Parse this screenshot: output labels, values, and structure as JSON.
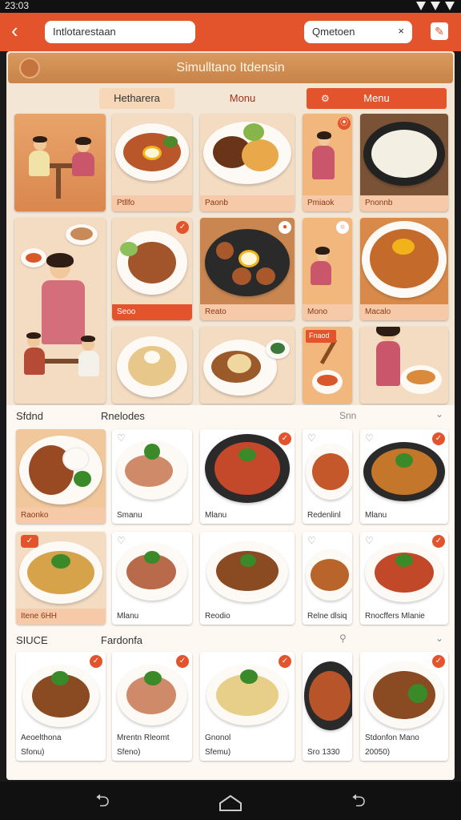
{
  "status_bar": {
    "time": "23:03"
  },
  "top_bar": {
    "url_text": "Intlotarestaan",
    "search_text": "Qmetoen",
    "search_clear": "×"
  },
  "banner": {
    "title": "Simulltano  Itdensin"
  },
  "tabs": [
    {
      "label": "Hetharera"
    },
    {
      "label": "Monu"
    },
    {
      "label": "Menu",
      "icon": "⚙"
    }
  ],
  "top_grid": [
    {
      "label": "",
      "badge": ""
    },
    {
      "label": "Ptllfo",
      "badge": ""
    },
    {
      "label": "Paonb",
      "badge": ""
    },
    {
      "label": "Pmiaok",
      "badge": "⦿"
    },
    {
      "label": "Pnonnb",
      "badge": ""
    },
    {
      "label": "",
      "badge": "✓"
    },
    {
      "label": "Seoo",
      "badge": "✓"
    },
    {
      "label": "Reato",
      "badge": "●"
    },
    {
      "label": "Mono",
      "badge": ""
    },
    {
      "label": "Macalo",
      "badge": "○"
    },
    {
      "label": "",
      "badge": ""
    },
    {
      "label": "",
      "badge": ""
    },
    {
      "label": "Fnaod",
      "badge": ""
    },
    {
      "label": "",
      "badge": "○"
    }
  ],
  "section1": {
    "title": "Sfdnd",
    "subtitle": "Rnelodes",
    "right": "Snn",
    "chevron": "⌄"
  },
  "section1_items": [
    {
      "label": "Raonko",
      "badge": ""
    },
    {
      "label": "Smanu",
      "badge": ""
    },
    {
      "label": "Mlanu",
      "badge": "✓"
    },
    {
      "label": "Redenlinl",
      "badge": ""
    },
    {
      "label": "Mlanu",
      "badge": "✓"
    },
    {
      "label": "Itene 6HH",
      "badge": ""
    },
    {
      "label": "Mlanu",
      "badge": ""
    },
    {
      "label": "Reodio",
      "badge": ""
    },
    {
      "label": "Relne dlsiq",
      "badge": ""
    },
    {
      "label": "Rnocffers Mlanie",
      "badge": "✓"
    }
  ],
  "section2": {
    "title": "SIUCE",
    "subtitle": "Fardonfa",
    "right": "⌄"
  },
  "section2_items": [
    {
      "label": "Aeoelthona",
      "sublabel": "Sfonu)",
      "badge": "✓"
    },
    {
      "label": "Mrentn Rleomt",
      "sublabel": "Sfeno)",
      "badge": "✓"
    },
    {
      "label": "Gnonol",
      "sublabel": "Sfemu)",
      "badge": "✓"
    },
    {
      "label": "Sro 1330",
      "sublabel": "",
      "badge": ""
    },
    {
      "label": "Stdonfon Mano",
      "sublabel": "20050)",
      "badge": "✓"
    }
  ],
  "colors": {
    "accent": "#e4542c",
    "page": "#f3e6d5",
    "wood": "#c7834a"
  },
  "nav": {
    "back": "⮌",
    "recent": "⮌"
  }
}
